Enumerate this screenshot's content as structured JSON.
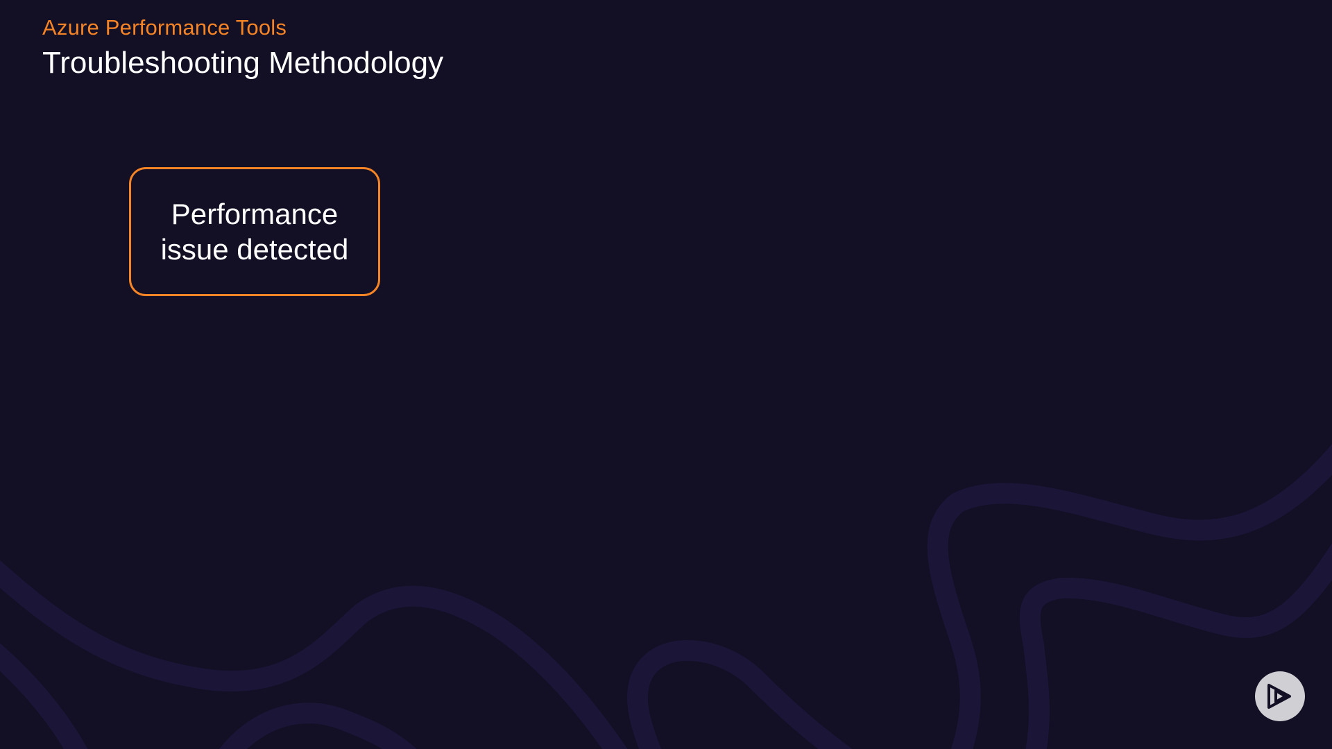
{
  "header": {
    "subtitle": "Azure Performance Tools",
    "title": "Troubleshooting Methodology"
  },
  "flow": {
    "steps": [
      {
        "label": "Performance\nissue detected"
      }
    ]
  },
  "colors": {
    "background": "#130f24",
    "accent": "#f58426",
    "text": "#ffffff",
    "wave": "#1b1538",
    "badge": "#cfcfd4"
  },
  "icons": {
    "brand": "play-logo-icon"
  }
}
